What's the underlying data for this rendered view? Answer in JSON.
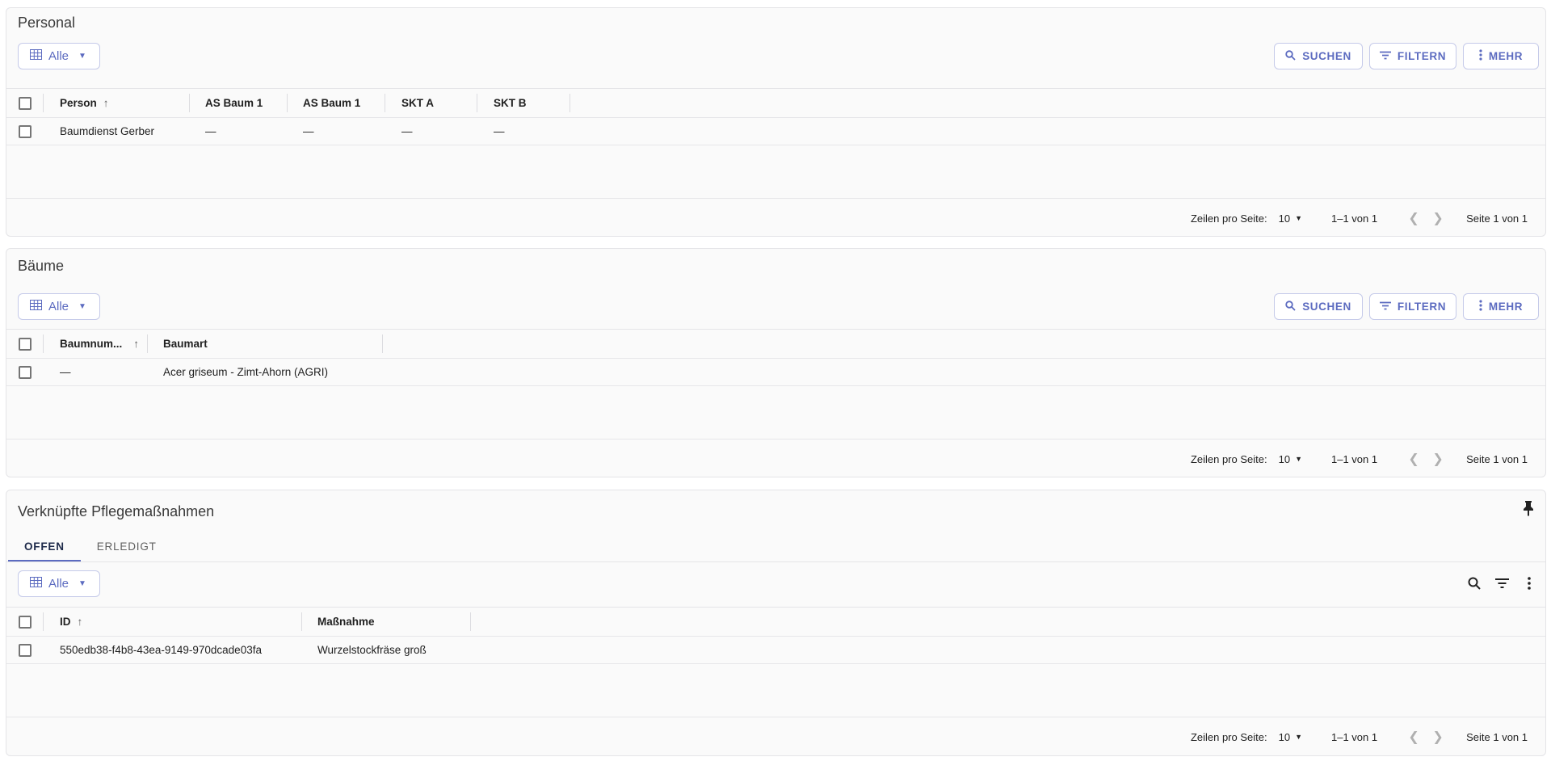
{
  "sections": [
    {
      "title": "Personal",
      "view_label": "Alle",
      "actions": {
        "search": "SUCHEN",
        "filter": "FILTERN",
        "more": "MEHR"
      },
      "columns": [
        "Person",
        "AS Baum 1",
        "AS Baum 1",
        "SKT A",
        "SKT B"
      ],
      "rows": [
        [
          "Baumdienst Gerber",
          "—",
          "—",
          "—",
          "—"
        ]
      ],
      "footer": {
        "rows_per_page_label": "Zeilen pro Seite:",
        "rows_per_page": "10",
        "range": "1–1 von 1",
        "page": "Seite 1 von 1"
      }
    },
    {
      "title": "Bäume",
      "view_label": "Alle",
      "actions": {
        "search": "SUCHEN",
        "filter": "FILTERN",
        "more": "MEHR"
      },
      "columns": [
        "Baumnum...",
        "Baumart"
      ],
      "rows": [
        [
          "—",
          "Acer griseum - Zimt-Ahorn (AGRI)"
        ]
      ],
      "footer": {
        "rows_per_page_label": "Zeilen pro Seite:",
        "rows_per_page": "10",
        "range": "1–1 von 1",
        "page": "Seite 1 von 1"
      }
    },
    {
      "title": "Verknüpfte Pflegemaßnahmen",
      "tabs": [
        "OFFEN",
        "ERLEDIGT"
      ],
      "active_tab": "OFFEN",
      "view_label": "Alle",
      "columns": [
        "ID",
        "Maßnahme"
      ],
      "rows": [
        [
          "550edb38-f4b8-43ea-9149-970dcade03fa",
          "Wurzelstockfräse groß"
        ]
      ],
      "footer": {
        "rows_per_page_label": "Zeilen pro Seite:",
        "rows_per_page": "10",
        "range": "1–1 von 1",
        "page": "Seite 1 von 1"
      }
    }
  ],
  "colors": {
    "accent": "#5c6bc0",
    "border": "#e4e4e7",
    "panel": "#fafafa"
  }
}
